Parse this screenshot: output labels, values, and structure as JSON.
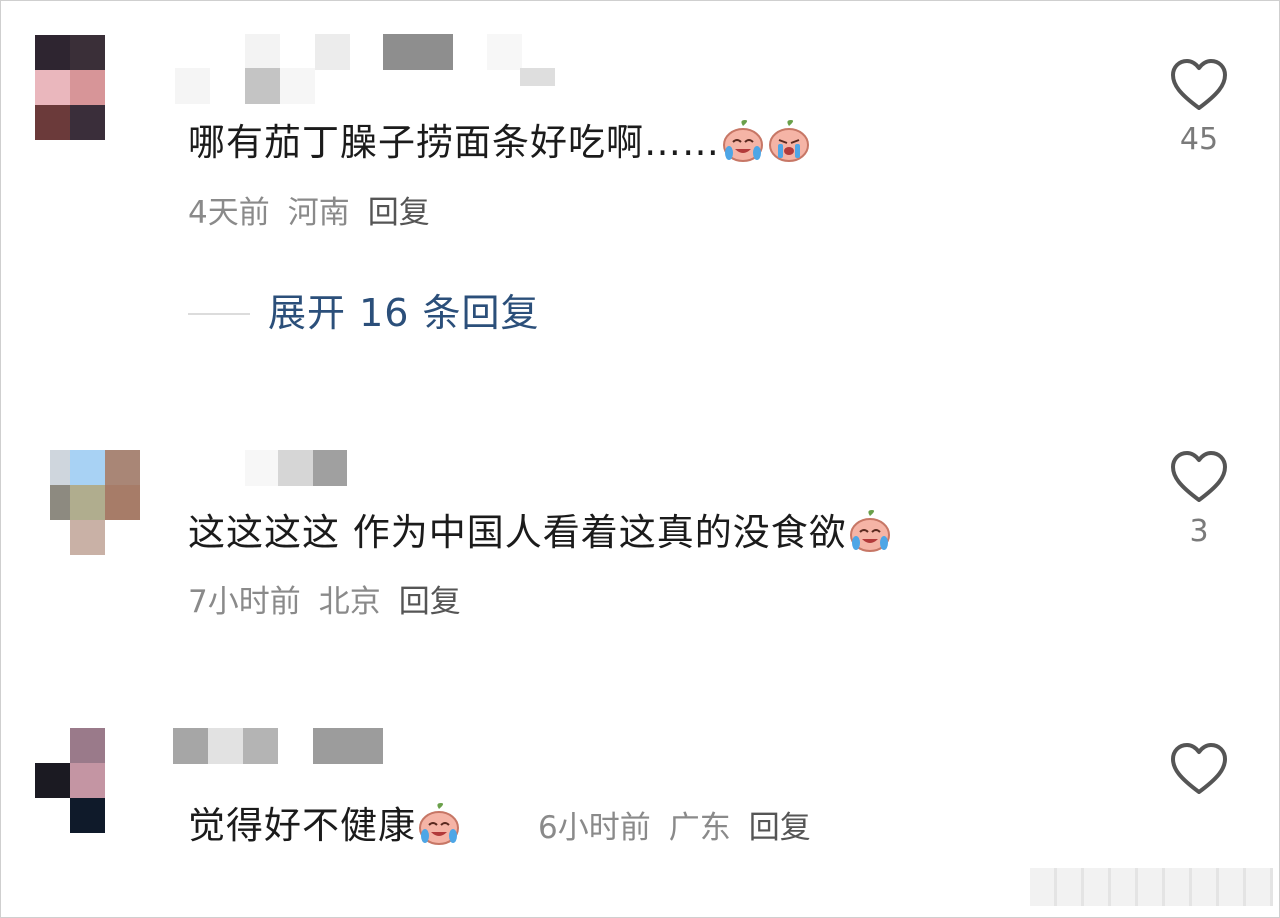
{
  "comments": [
    {
      "text": "哪有茄丁臊子捞面条好吃啊……",
      "emoji_count": 2,
      "time": "4天前",
      "location": "河南",
      "reply_label": "回复",
      "likes": "45",
      "expand_label": "展开 16 条回复"
    },
    {
      "text": "这这这这 作为中国人看着这真的没食欲",
      "emoji_count": 1,
      "time": "7小时前",
      "location": "北京",
      "reply_label": "回复",
      "likes": "3"
    },
    {
      "text": "觉得好不健康",
      "emoji_count": 1,
      "time": "6小时前",
      "location": "广东",
      "reply_label": "回复",
      "likes": ""
    }
  ],
  "icons": {
    "like": "heart-outline-icon",
    "emoji": "crying-laughing-emoji-icon"
  },
  "colors": {
    "text": "#1b1b1b",
    "meta": "#8a8a8a",
    "expand_link": "#2b4f7a",
    "heart_stroke": "#555555"
  }
}
